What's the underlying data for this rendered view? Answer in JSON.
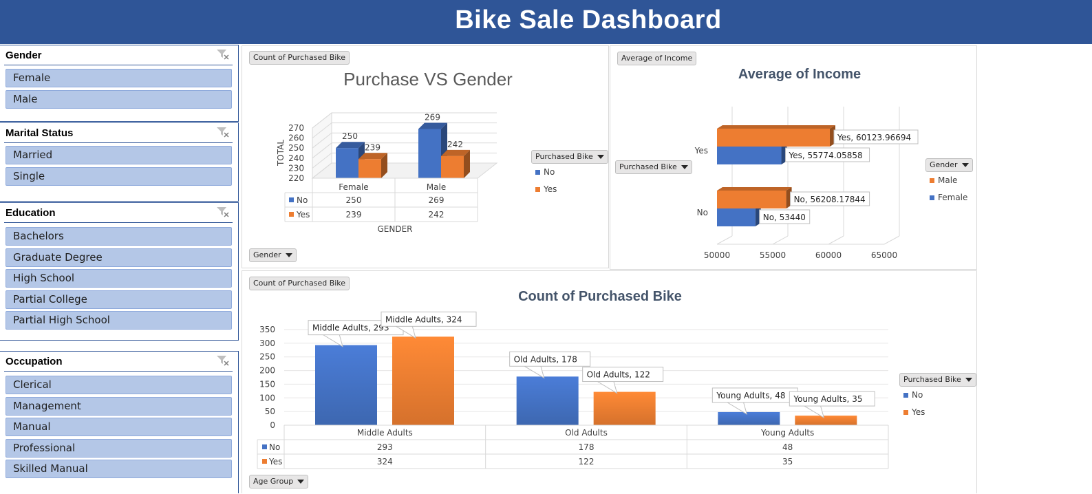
{
  "dashboard": {
    "title": "Bike Sale Dashboard"
  },
  "colors": {
    "header": "#2f5597",
    "series_no": "#4472c4",
    "series_yes": "#ed7d31",
    "slicer_item": "#b4c7e7"
  },
  "slicers": {
    "gender": {
      "title": "Gender",
      "items": [
        "Female",
        "Male"
      ]
    },
    "marital": {
      "title": "Marital Status",
      "items": [
        "Married",
        "Single"
      ]
    },
    "education": {
      "title": "Education",
      "items": [
        "Bachelors",
        "Graduate Degree",
        "High School",
        "Partial College",
        "Partial High School"
      ]
    },
    "occupation": {
      "title": "Occupation",
      "items": [
        "Clerical",
        "Management",
        "Manual",
        "Professional",
        "Skilled Manual"
      ]
    }
  },
  "panels": {
    "gender_chart": {
      "value_button": "Count of Purchased Bike",
      "axis_button": "Gender",
      "legend_button": "Purchased Bike",
      "legend": [
        "No",
        "Yes"
      ]
    },
    "income_chart": {
      "value_button": "Average of Income",
      "axis_button": "Purchased Bike",
      "legend_button": "Gender",
      "legend": [
        "Male",
        "Female"
      ]
    },
    "age_chart": {
      "value_button": "Count of Purchased Bike",
      "axis_button": "Age Group",
      "legend_button": "Purchased Bike",
      "legend": [
        "No",
        "Yes"
      ]
    }
  },
  "chart_data": [
    {
      "type": "bar",
      "title": "Purchase VS Gender",
      "ylabel": "TOTAL",
      "xlabel": "GENDER",
      "categories": [
        "Female",
        "Male"
      ],
      "series": [
        {
          "name": "No",
          "values": [
            250,
            269
          ]
        },
        {
          "name": "Yes",
          "values": [
            239,
            242
          ]
        }
      ],
      "ylim": [
        220,
        270
      ],
      "yticks": [
        "220",
        "230",
        "240",
        "250",
        "260",
        "270"
      ],
      "data_labels": [
        "250",
        "269",
        "239",
        "242"
      ],
      "data_table": {
        "rows": [
          {
            "name": "No",
            "cells": [
              "250",
              "269"
            ]
          },
          {
            "name": "Yes",
            "cells": [
              "239",
              "242"
            ]
          }
        ]
      },
      "grid": true,
      "legend_position": "right"
    },
    {
      "type": "bar",
      "orientation": "horizontal",
      "title": "Average of Income",
      "categories": [
        "No",
        "Yes"
      ],
      "series": [
        {
          "name": "Female",
          "values": [
            53440,
            55774.05858
          ]
        },
        {
          "name": "Male",
          "values": [
            56208.17844,
            60123.96694
          ]
        }
      ],
      "xlim": [
        50000,
        65000
      ],
      "xticks": [
        "50000",
        "55000",
        "60000",
        "65000"
      ],
      "data_labels": [
        "Yes, 60123.96694",
        "Yes, 55774.05858",
        "No, 56208.17844",
        "No, 53440"
      ],
      "grid": true,
      "legend_position": "right"
    },
    {
      "type": "bar",
      "title": "Count of Purchased Bike",
      "categories": [
        "Middle Adults",
        "Old Adults",
        "Young Adults"
      ],
      "series": [
        {
          "name": "No",
          "values": [
            293,
            178,
            48
          ]
        },
        {
          "name": "Yes",
          "values": [
            324,
            122,
            35
          ]
        }
      ],
      "ylim": [
        0,
        350
      ],
      "yticks": [
        "0",
        "50",
        "100",
        "150",
        "200",
        "250",
        "300",
        "350"
      ],
      "data_labels": [
        "Middle Adults, 293",
        "Middle Adults, 324",
        "Old Adults, 178",
        "Old Adults, 122",
        "Young Adults, 48",
        "Young Adults, 35"
      ],
      "data_table": {
        "rows": [
          {
            "name": "No",
            "cells": [
              "293",
              "178",
              "48"
            ]
          },
          {
            "name": "Yes",
            "cells": [
              "324",
              "122",
              "35"
            ]
          }
        ]
      },
      "grid": true,
      "legend_position": "right"
    }
  ]
}
